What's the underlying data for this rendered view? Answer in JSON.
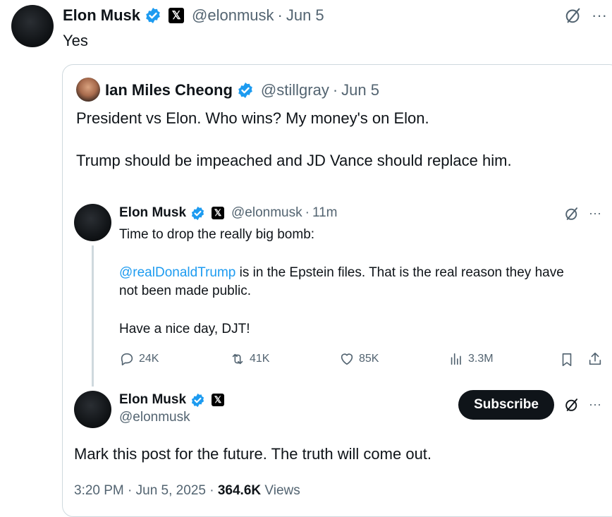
{
  "main_post": {
    "author_name": "Elon Musk",
    "handle": "@elonmusk",
    "separator": "·",
    "date": "Jun 5",
    "text": "Yes"
  },
  "quoted_post": {
    "author_name": "Ian Miles Cheong",
    "handle": "@stillgray",
    "separator": "·",
    "date": "Jun 5",
    "line1": "President vs Elon. Who wins? My money's on Elon.",
    "line2": "Trump should be impeached and JD Vance should replace him."
  },
  "embedded_post": {
    "author_name": "Elon Musk",
    "handle": "@elonmusk",
    "separator": "·",
    "time_ago": "11m",
    "line1": "Time to drop the really big bomb:",
    "mention": "@realDonaldTrump",
    "line2_rest": " is in the Epstein files. That is the real reason they have",
    "line3": "not been made public.",
    "line4": "Have a nice day, DJT!",
    "stats": {
      "replies": "24K",
      "reposts": "41K",
      "likes": "85K",
      "views": "3.3M"
    }
  },
  "thread_post": {
    "author_name": "Elon Musk",
    "handle": "@elonmusk",
    "subscribe_label": "Subscribe",
    "text": "Mark this post for the future. The truth will come out.",
    "timestamp": "3:20 PM · Jun 5, 2025 · ",
    "views_count": "364.6K",
    "views_label": " Views"
  },
  "colors": {
    "verified_blue": "#1d9bf0",
    "text_primary": "#0f1419",
    "text_muted": "#536471",
    "border": "#cfd9de"
  }
}
